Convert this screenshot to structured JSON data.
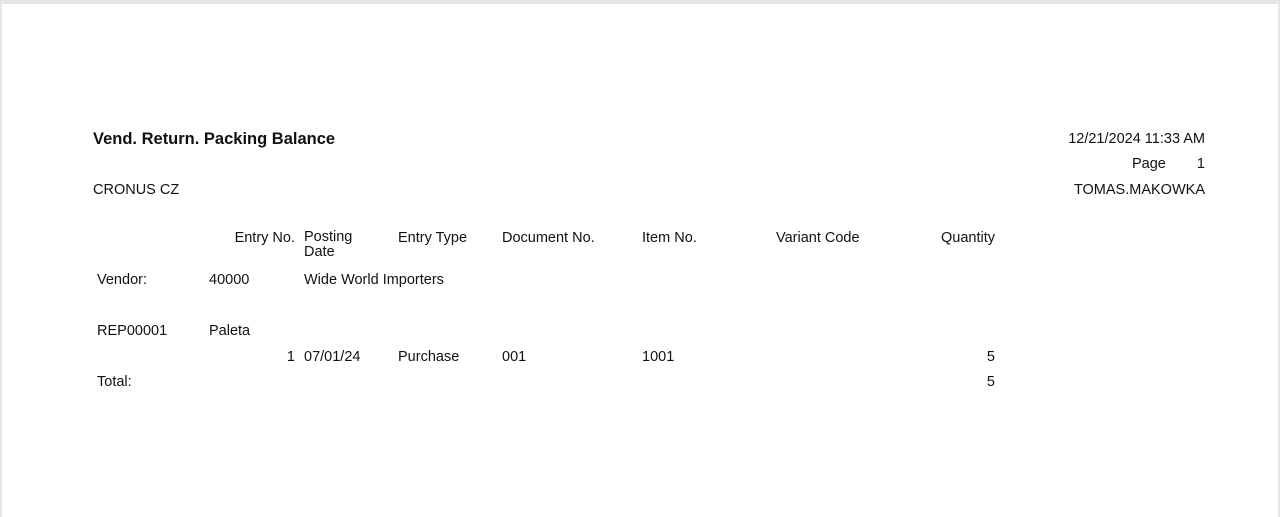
{
  "report": {
    "title": "Vend. Return. Packing Balance",
    "datetime": "12/21/2024 11:33 AM",
    "page_label": "Page",
    "page_number": "1",
    "company": "CRONUS CZ",
    "user": "TOMAS.MAKOWKA"
  },
  "columns": {
    "entry_no": "Entry No.",
    "posting_date": "Posting Date",
    "entry_type": "Entry Type",
    "document_no": "Document No.",
    "item_no": "Item No.",
    "variant_code": "Variant Code",
    "quantity": "Quantity"
  },
  "vendor": {
    "label": "Vendor:",
    "number": "40000",
    "name": "Wide World Importers"
  },
  "group": {
    "code": "REP00001",
    "description": "Paleta"
  },
  "rows": [
    {
      "entry_no": "1",
      "posting_date": "07/01/24",
      "entry_type": "Purchase",
      "document_no": "001",
      "item_no": "1001",
      "variant_code": "",
      "quantity": "5"
    }
  ],
  "total": {
    "label": "Total:",
    "quantity": "5"
  }
}
